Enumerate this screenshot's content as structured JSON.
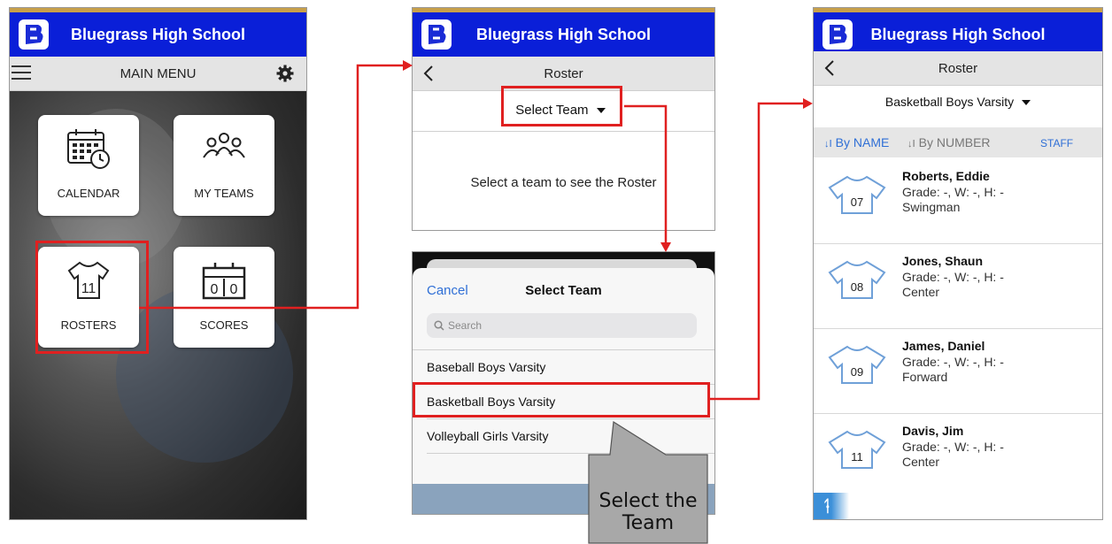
{
  "panel1": {
    "header_title": "Bluegrass High School",
    "menu_label": "MAIN MENU",
    "tiles": {
      "calendar": "CALENDAR",
      "my_teams": "MY TEAMS",
      "rosters": "ROSTERS",
      "scores": "SCORES"
    },
    "jersey_number": "11",
    "score_digits": [
      "0",
      "0"
    ]
  },
  "panel2": {
    "header_title": "Bluegrass High School",
    "nav_title": "Roster",
    "select_team_label": "Select Team",
    "empty_message": "Select a team to see the Roster"
  },
  "panel3": {
    "cancel_label": "Cancel",
    "sheet_title": "Select Team",
    "search_placeholder": "Search",
    "teams": [
      "Baseball Boys Varsity",
      "Basketball Boys Varsity",
      "Volleyball Girls Varsity"
    ]
  },
  "callout": {
    "text": "Select the Team"
  },
  "panel4": {
    "header_title": "Bluegrass High School",
    "nav_title": "Roster",
    "selected_team": "Basketball Boys Varsity",
    "sort_by_name": "By NAME",
    "sort_by_number": "By NUMBER",
    "staff_label": "STAFF",
    "players": [
      {
        "name": "Roberts, Eddie",
        "details": "Grade: -, W: -, H: -",
        "position": "Swingman",
        "number": "07"
      },
      {
        "name": "Jones, Shaun",
        "details": "Grade: -, W: -, H: -",
        "position": "Center",
        "number": "08"
      },
      {
        "name": "James, Daniel",
        "details": "Grade: -, W: -, H: -",
        "position": "Forward",
        "number": "09"
      },
      {
        "name": "Davis, Jim",
        "details": "Grade: -, W: -, H: -",
        "position": "Center",
        "number": "11"
      }
    ]
  },
  "colors": {
    "header_blue": "#0a1fd8",
    "highlight_red": "#e02020",
    "ios_blue": "#2f6fd6",
    "callout_gray": "#a8a8a8"
  }
}
